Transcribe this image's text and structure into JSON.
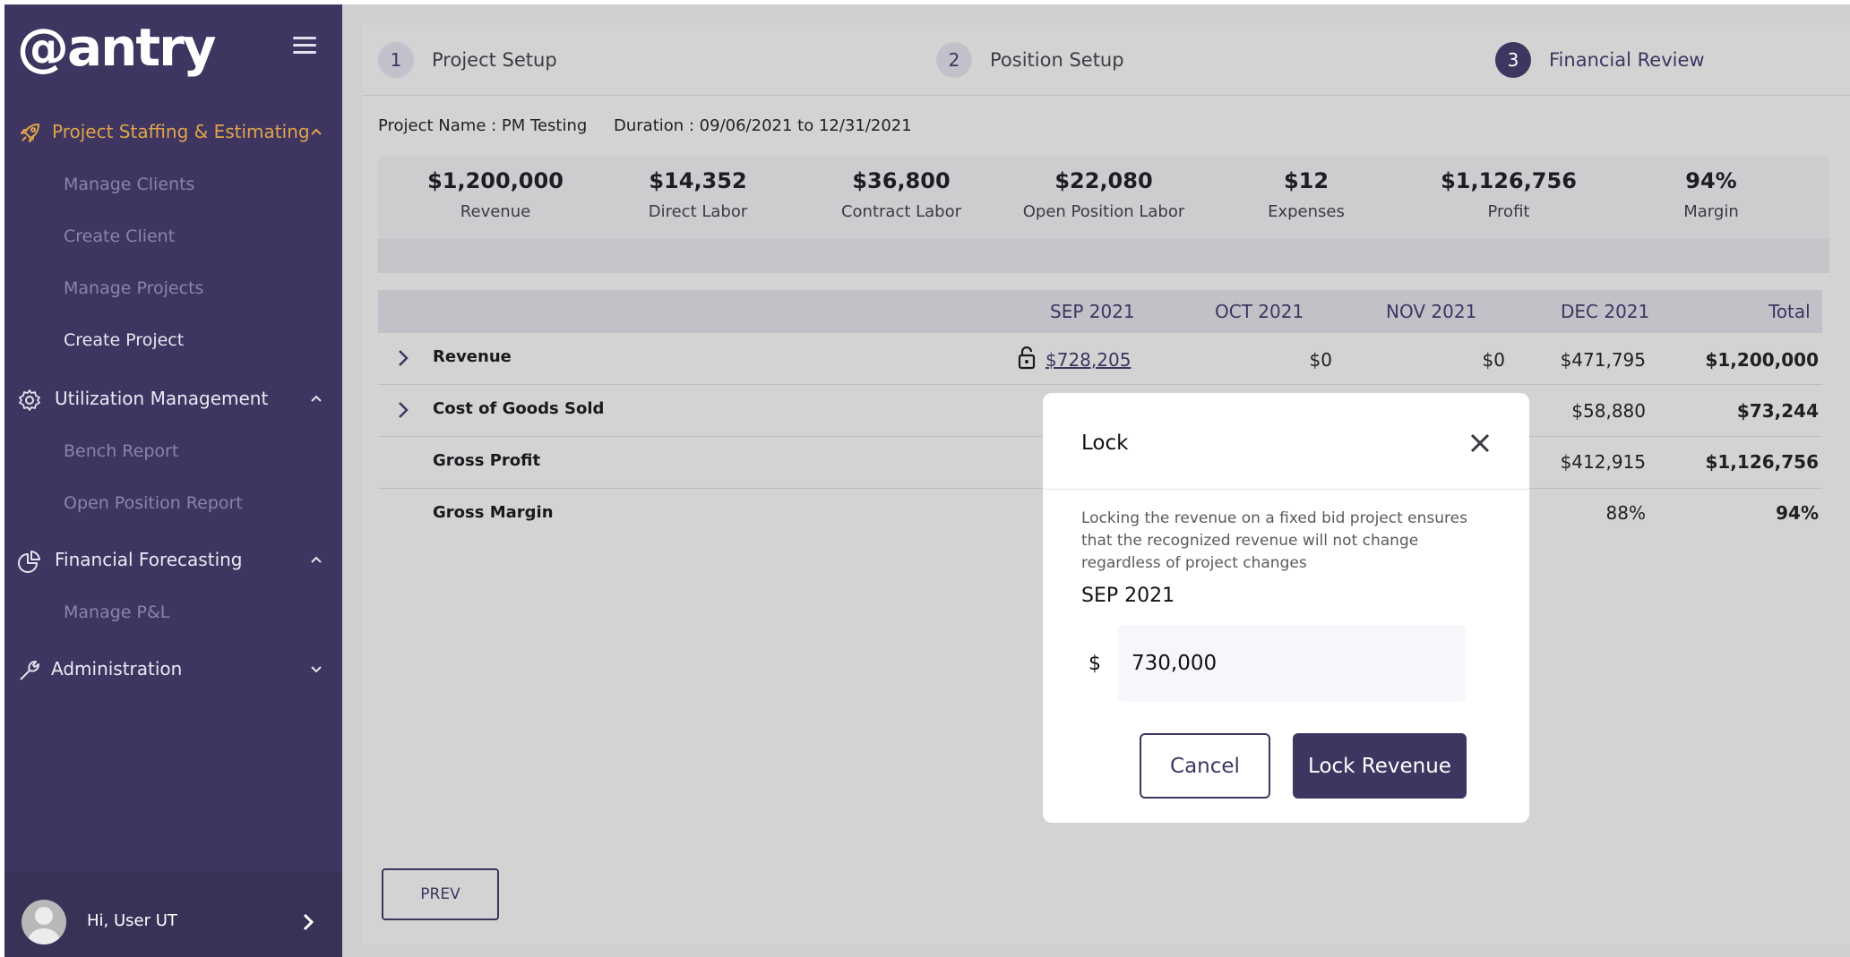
{
  "brand": {
    "logo_text": "@antry"
  },
  "sidebar": {
    "sections": [
      {
        "label": "Project Staffing & Estimating",
        "icon": "rocket-icon",
        "expanded": true,
        "color": "#e0a44a"
      },
      {
        "label": "Utilization Management",
        "icon": "gear-icon",
        "expanded": true
      },
      {
        "label": "Financial Forecasting",
        "icon": "pie-chart-icon",
        "expanded": true
      },
      {
        "label": "Administration",
        "icon": "wrench-icon",
        "expanded": false
      }
    ],
    "items": [
      {
        "label": "Manage Clients"
      },
      {
        "label": "Create Client"
      },
      {
        "label": "Manage Projects"
      },
      {
        "label": "Create Project",
        "active": true
      },
      {
        "label": "Bench Report"
      },
      {
        "label": "Open Position Report"
      },
      {
        "label": "Manage P&L"
      }
    ],
    "user": {
      "greeting": "Hi, User  UT"
    }
  },
  "steps": [
    {
      "num": "1",
      "label": "Project Setup"
    },
    {
      "num": "2",
      "label": "Position Setup"
    },
    {
      "num": "3",
      "label": "Financial Review",
      "active": true
    }
  ],
  "project": {
    "name": "Project Name : PM Testing",
    "duration": "Duration : 09/06/2021 to 12/31/2021"
  },
  "kpis": [
    {
      "value": "$1,200,000",
      "label": "Revenue"
    },
    {
      "value": "$14,352",
      "label": "Direct Labor"
    },
    {
      "value": "$36,800",
      "label": "Contract Labor"
    },
    {
      "value": "$22,080",
      "label": "Open Position Labor"
    },
    {
      "value": "$12",
      "label": "Expenses"
    },
    {
      "value": "$1,126,756",
      "label": "Profit"
    },
    {
      "value": "94%",
      "label": "Margin"
    }
  ],
  "table": {
    "columns": [
      "SEP 2021",
      "OCT 2021",
      "NOV 2021",
      "DEC 2021",
      "Total"
    ],
    "rows": [
      {
        "label": "Revenue",
        "sep": "$728,205",
        "oct": "$0",
        "nov": "$0",
        "dec": "$471,795",
        "total": "$1,200,000"
      },
      {
        "label": "Cost of Goods Sold",
        "dec": "$58,880",
        "total": "$73,244"
      },
      {
        "label": "Gross Profit",
        "dec": "$412,915",
        "total": "$1,126,756"
      },
      {
        "label": "Gross Margin",
        "dec": "88%",
        "total": "94%"
      }
    ]
  },
  "footer": {
    "prev_label": "PREV"
  },
  "modal": {
    "title": "Lock",
    "description": "Locking the revenue on a fixed bid project ensures that the recognized revenue will not change regardless of project changes",
    "month": "SEP 2021",
    "currency": "$",
    "amount": "730,000",
    "cancel_label": "Cancel",
    "confirm_label": "Lock Revenue"
  },
  "colors": {
    "brand": "#3e3560",
    "accent": "#e0a44a"
  }
}
